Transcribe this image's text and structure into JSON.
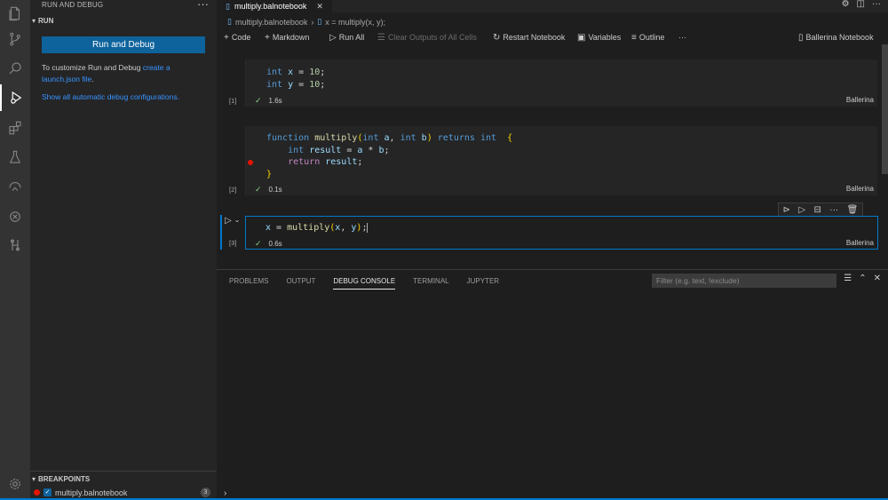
{
  "activity_bar": {
    "icons": [
      "explorer-icon",
      "source-control-icon",
      "search-icon",
      "run-debug-icon",
      "extensions-icon",
      "testing-icon",
      "remote-icon",
      "ballerina-icon",
      "choreo-icon",
      "manage-gear-icon"
    ]
  },
  "sidebar": {
    "title": "RUN AND DEBUG",
    "more": "···",
    "section": "RUN",
    "run_button": "Run and Debug",
    "customize_text": "To customize Run and Debug ",
    "customize_link": "create a launch.json file",
    "customize_end": ".",
    "show_all_link": "Show all automatic debug configurations.",
    "breakpoints_header": "BREAKPOINTS",
    "breakpoint_file": "multiply.balnotebook",
    "breakpoint_count": "3"
  },
  "tab": {
    "label": "multiply.balnotebook",
    "close": "✕"
  },
  "breadcrumb": {
    "file": "multiply.balnotebook",
    "separator": "›",
    "cell": "x = multiply(x, y);"
  },
  "toolbar": {
    "code": "Code",
    "markdown": "Markdown",
    "run_all": "Run All",
    "clear_outputs": "Clear Outputs of All Cells",
    "restart": "Restart Notebook",
    "variables": "Variables",
    "outline": "Outline",
    "more": "···",
    "kernel": "Ballerina Notebook"
  },
  "cells": [
    {
      "count": "[1]",
      "time": "1.6s",
      "lang": "Ballerina"
    },
    {
      "count": "[2]",
      "time": "0.1s",
      "lang": "Ballerina"
    },
    {
      "count": "[3]",
      "time": "0.6s",
      "lang": "Ballerina"
    }
  ],
  "panel": {
    "tabs": [
      "PROBLEMS",
      "OUTPUT",
      "DEBUG CONSOLE",
      "TERMINAL",
      "JUPYTER"
    ],
    "active_tab": "DEBUG CONSOLE",
    "filter_placeholder": "Filter (e.g. text, !exclude)",
    "prompt": "›"
  },
  "colors": {
    "accent": "#007acc",
    "button": "#0e639c",
    "breakpoint": "#e51400",
    "success": "#89d185"
  }
}
